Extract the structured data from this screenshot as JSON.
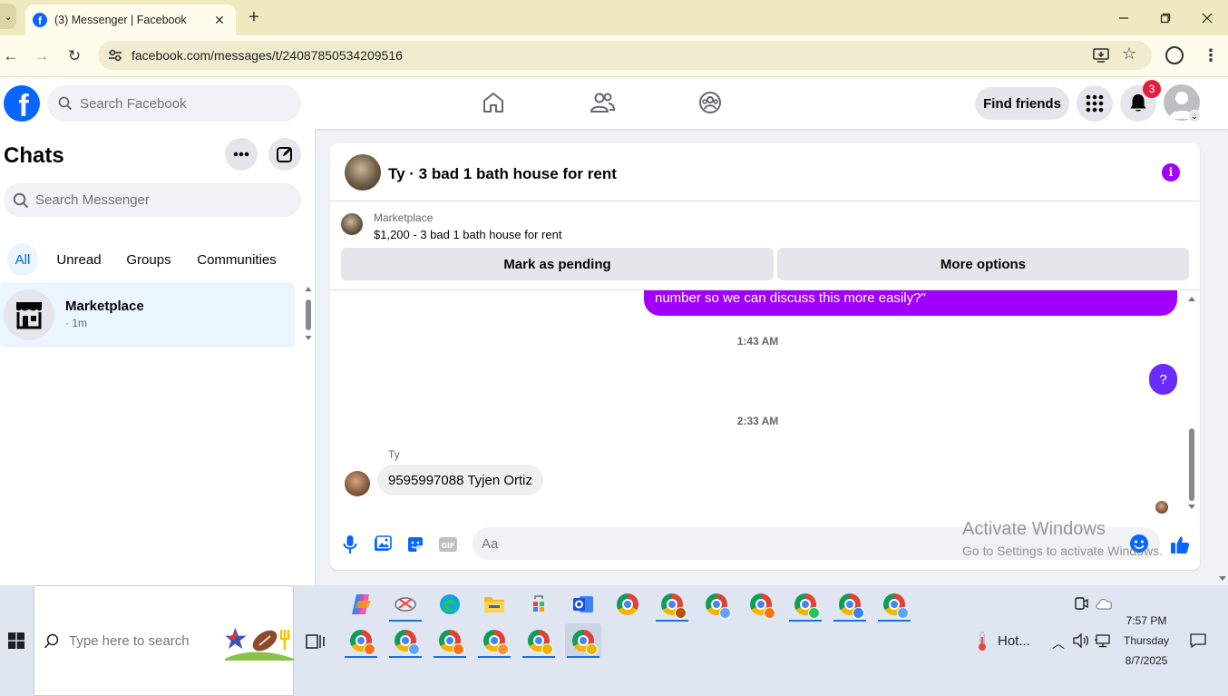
{
  "browser": {
    "tab_title": "(3) Messenger | Facebook",
    "url": "facebook.com/messages/t/24087850534209516"
  },
  "header": {
    "search_placeholder": "Search Facebook",
    "find_friends_label": "Find friends",
    "notification_count": "3"
  },
  "chats_panel": {
    "title": "Chats",
    "search_placeholder": "Search Messenger",
    "filters": [
      "All",
      "Unread",
      "Groups",
      "Communities"
    ],
    "active_filter": "All",
    "items": [
      {
        "name": "Marketplace",
        "time": "· 1m"
      }
    ]
  },
  "conversation": {
    "title": "Ty · 3 bad 1 bath house for rent",
    "marketplace_label": "Marketplace",
    "listing": "$1,200 - 3 bad 1 bath house for rent",
    "mark_pending_label": "Mark as pending",
    "more_options_label": "More options",
    "outgoing_partial": "number so we can discuss this more easily?\"",
    "timestamp_1": "1:43 AM",
    "outgoing_q": "?",
    "timestamp_2": "2:33 AM",
    "sender_name": "Ty",
    "incoming_message": "9595997088 Tyjen Ortiz",
    "composer_placeholder": "Aa"
  },
  "watermark": {
    "line1": "Activate Windows",
    "line2": "Go to Settings to activate Windows."
  },
  "taskbar": {
    "search_placeholder": "Type here to search",
    "weather": "Hot...",
    "time": "7:57 PM",
    "day": "Thursday",
    "date": "8/7/2025"
  },
  "colors": {
    "facebook_blue": "#0866ff",
    "messenger_purple": "#a100ff",
    "notification_red": "#e41e3f"
  }
}
